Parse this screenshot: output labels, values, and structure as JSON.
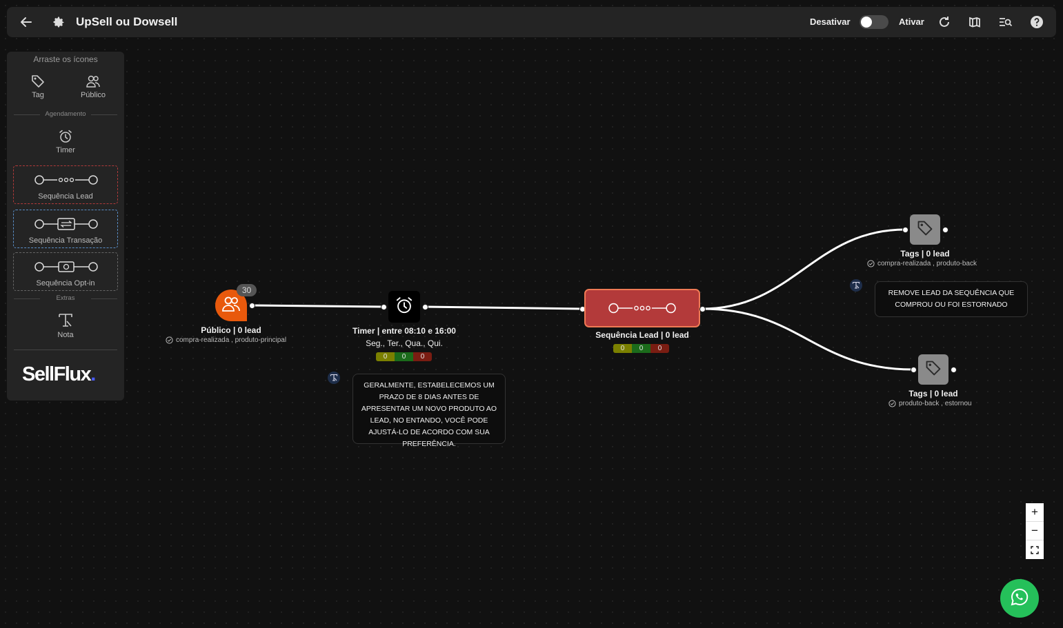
{
  "topbar": {
    "title": "UpSell ou Dowsell",
    "deactivate_label": "Desativar",
    "activate_label": "Ativar",
    "toggle_on": false
  },
  "palette": {
    "header": "Arraste os ícones",
    "tag_label": "Tag",
    "audience_label": "Público",
    "scheduling_section": "Agendamento",
    "timer_label": "Timer",
    "lead_sequence_label": "Sequência Lead",
    "transaction_sequence_label": "Sequência Transação",
    "optin_sequence_label": "Sequência Opt-in",
    "extras_section": "Extras",
    "note_label": "Nota",
    "logo_text": "SellFlux",
    "logo_dot": "."
  },
  "nodes": {
    "publico": {
      "badge": "30",
      "label": "Público | 0 lead",
      "sub": "compra-realizada , produto-principal",
      "color": "#e8590c"
    },
    "timer": {
      "label": "Timer | entre 08:10 e 16:00",
      "days": "Seg., Ter., Qua., Qui.",
      "counters": [
        "0",
        "0",
        "0"
      ]
    },
    "sequence": {
      "label": "Sequência Lead | 0 lead",
      "counters": [
        "0",
        "0",
        "0"
      ],
      "color": "#b33a3a"
    },
    "tags_top": {
      "label": "Tags | 0 lead",
      "sub": "compra-realizada , produto-back"
    },
    "tags_bottom": {
      "label": "Tags | 0 lead",
      "sub": "produto-back , estornou"
    }
  },
  "notes": {
    "note1": "GERALMENTE, ESTABELECEMOS UM PRAZO DE 8 DIAS ANTES DE APRESENTAR UM NOVO PRODUTO AO LEAD, NO ENTANDO, VOCÊ PODE AJUSTÁ-LO DE ACORDO COM SUA PREFERÊNCIA.",
    "note2": "REMOVE LEAD DA SEQUÊNCIA QUE COMPROU OU FOI ESTORNADO"
  },
  "colors": {
    "accent_orange": "#e8590c",
    "sequence_red": "#b33a3a",
    "whatsapp_green": "#25c05a"
  }
}
